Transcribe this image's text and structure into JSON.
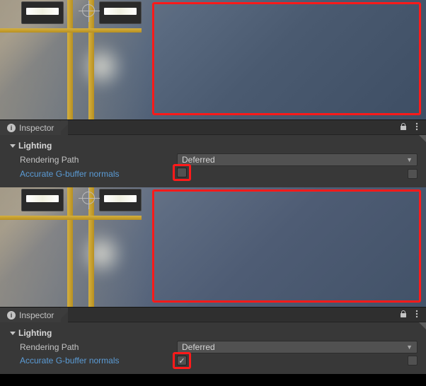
{
  "panels": [
    {
      "inspector_label": "Inspector",
      "section_label": "Lighting",
      "rows": {
        "rendering_path": {
          "label": "Rendering Path",
          "value": "Deferred"
        },
        "accurate_normals": {
          "label": "Accurate G-buffer normals",
          "checked": false
        }
      }
    },
    {
      "inspector_label": "Inspector",
      "section_label": "Lighting",
      "rows": {
        "rendering_path": {
          "label": "Rendering Path",
          "value": "Deferred"
        },
        "accurate_normals": {
          "label": "Accurate G-buffer normals",
          "checked": true
        }
      }
    }
  ],
  "icons": {
    "lock": "lock-icon",
    "menu": "menu-icon",
    "info": "i"
  }
}
